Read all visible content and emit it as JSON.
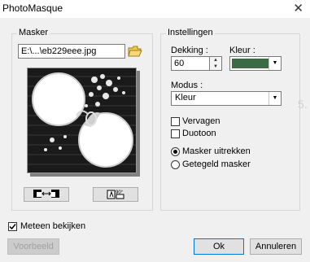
{
  "window": {
    "title": "PhotoMasque"
  },
  "masker": {
    "group_label": "Masker",
    "file_value": "E:\\...\\eb229eee.jpg"
  },
  "instellingen": {
    "group_label": "Instellingen",
    "dekking_label": "Dekking :",
    "dekking_value": "60",
    "kleur_label": "Kleur :",
    "kleur_color": "#3b6b45",
    "modus_label": "Modus :",
    "modus_value": "Kleur",
    "vervagen_label": "Vervagen",
    "duotoon_label": "Duotoon",
    "masker_uitrekken_label": "Masker uitrekken",
    "getegeld_masker_label": "Getegeld masker",
    "faint_number": "5."
  },
  "meteen_bekijken_label": "Meteen bekijken",
  "buttons": {
    "voorbeeld": "Voorbeeld",
    "ok": "Ok",
    "annuleren": "Annuleren"
  }
}
